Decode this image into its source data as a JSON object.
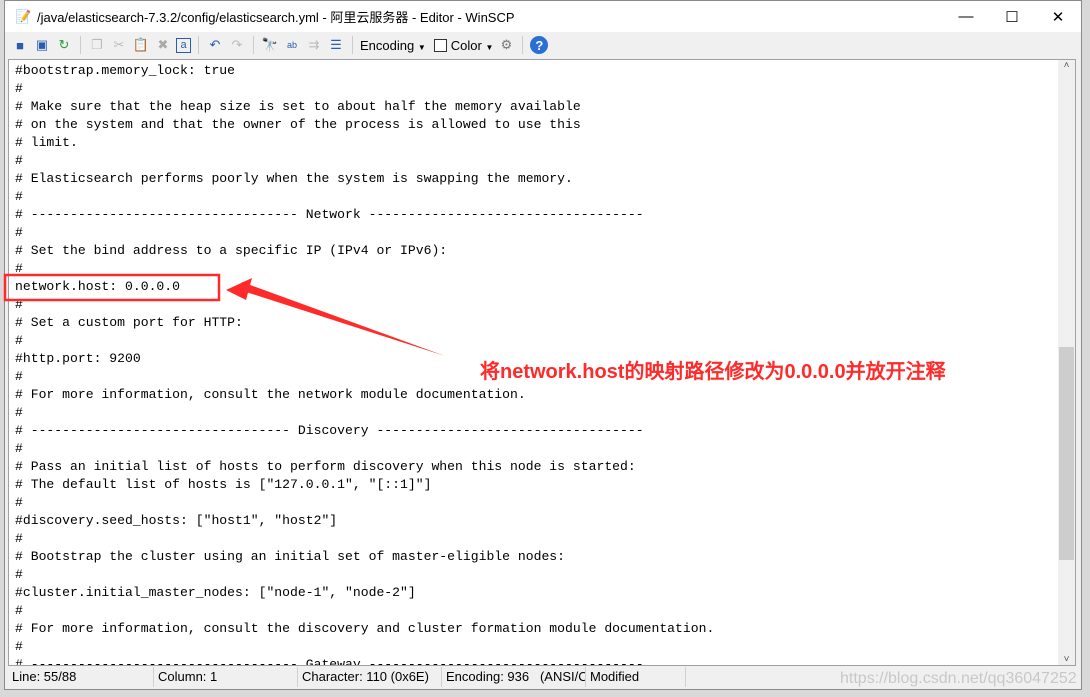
{
  "window": {
    "title": "/java/elasticsearch-7.3.2/config/elasticsearch.yml - 阿里云服务器 - Editor - WinSCP",
    "minimize": "—",
    "maximize": "☐",
    "close": "✕"
  },
  "toolbar": {
    "encoding_label": "Encoding",
    "color_label": "Color",
    "icons": [
      "save-icon",
      "save-all-icon",
      "reload-icon",
      "copy-icon",
      "cut-icon",
      "paste-icon",
      "delete-icon",
      "select-all-icon",
      "undo-icon",
      "redo-icon",
      "find-icon",
      "replace-icon",
      "find-next-icon",
      "goto-line-icon",
      "settings-icon",
      "help-icon"
    ]
  },
  "editor": {
    "lines": [
      "#bootstrap.memory_lock: true",
      "#",
      "# Make sure that the heap size is set to about half the memory available",
      "# on the system and that the owner of the process is allowed to use this",
      "# limit.",
      "#",
      "# Elasticsearch performs poorly when the system is swapping the memory.",
      "#",
      "# ---------------------------------- Network -----------------------------------",
      "#",
      "# Set the bind address to a specific IP (IPv4 or IPv6):",
      "#",
      "network.host: 0.0.0.0",
      "#",
      "# Set a custom port for HTTP:",
      "#",
      "#http.port: 9200",
      "#",
      "# For more information, consult the network module documentation.",
      "#",
      "# --------------------------------- Discovery ----------------------------------",
      "#",
      "# Pass an initial list of hosts to perform discovery when this node is started:",
      "# The default list of hosts is [\"127.0.0.1\", \"[::1]\"]",
      "#",
      "#discovery.seed_hosts: [\"host1\", \"host2\"]",
      "#",
      "# Bootstrap the cluster using an initial set of master-eligible nodes:",
      "#",
      "#cluster.initial_master_nodes: [\"node-1\", \"node-2\"]",
      "#",
      "# For more information, consult the discovery and cluster formation module documentation.",
      "#",
      "# ---------------------------------- Gateway -----------------------------------"
    ]
  },
  "status": {
    "line": "Line: 55/88",
    "column": "Column: 1",
    "character": "Character: 110 (0x6E)",
    "encoding": "Encoding: 936   (ANSI/C",
    "modified": "Modified"
  },
  "annotation": {
    "text": "将network.host的映射路径修改为0.0.0.0并放开注释",
    "color": "#ff2a2a"
  },
  "watermark": "https://blog.csdn.net/qq36047252"
}
